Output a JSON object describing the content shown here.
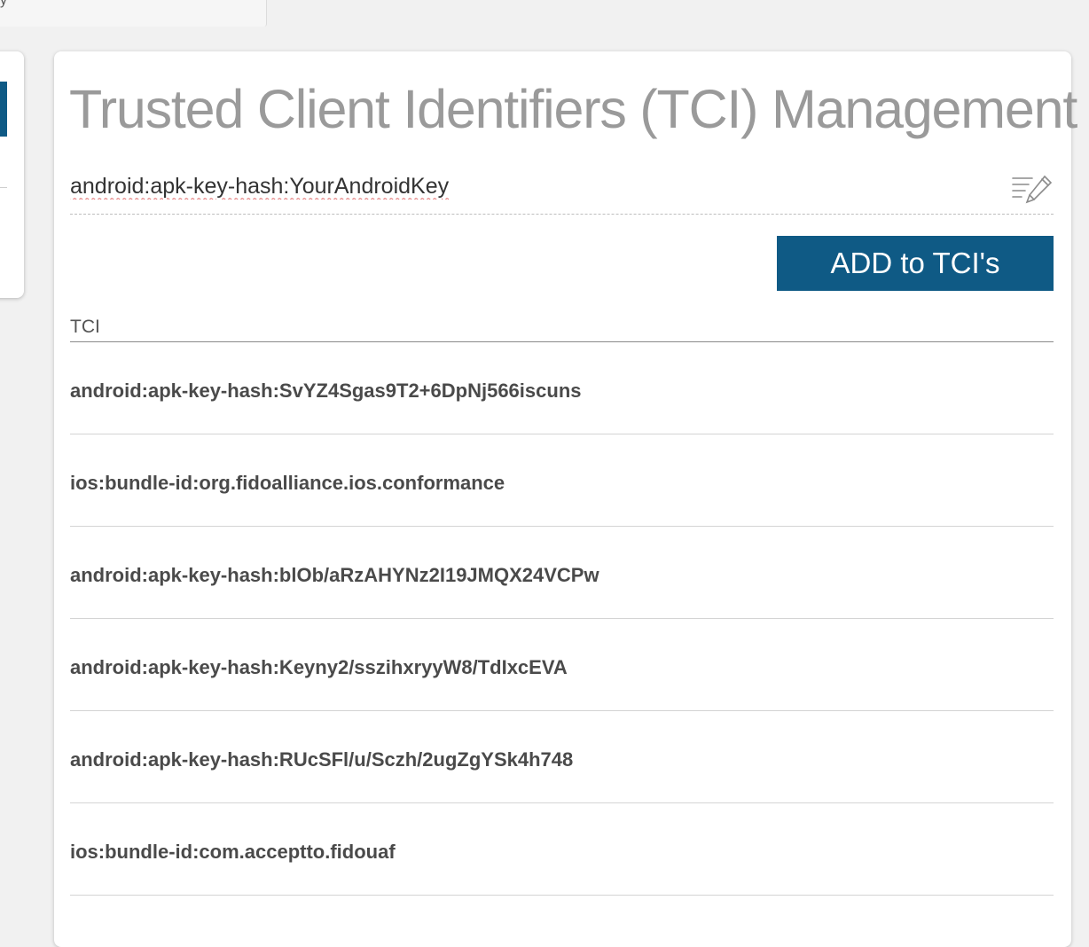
{
  "page": {
    "title": "Trusted Client Identifiers (TCI) Management"
  },
  "tci_input": {
    "value": "android:apk-key-hash:YourAndroidKey",
    "icon": "edit-list-icon"
  },
  "add_button": {
    "label": "ADD to TCI's"
  },
  "table": {
    "column_header": "TCI",
    "rows": [
      "android:apk-key-hash:SvYZ4Sgas9T2+6DpNj566iscuns",
      "ios:bundle-id:org.fidoalliance.ios.conformance",
      "android:apk-key-hash:blOb/aRzAHYNz2I19JMQX24VCPw",
      "android:apk-key-hash:Keyny2/sszihxryyW8/TdIxcEVA",
      "android:apk-key-hash:RUcSFl/u/Sczh/2ugZgYSk4h748",
      "ios:bundle-id:com.acceptto.fidouaf"
    ]
  },
  "colors": {
    "accent": "#0f5a85",
    "background": "#f1f1f1",
    "card": "#ffffff",
    "title": "#9a9a9a",
    "row_text": "#4a4a4a"
  }
}
